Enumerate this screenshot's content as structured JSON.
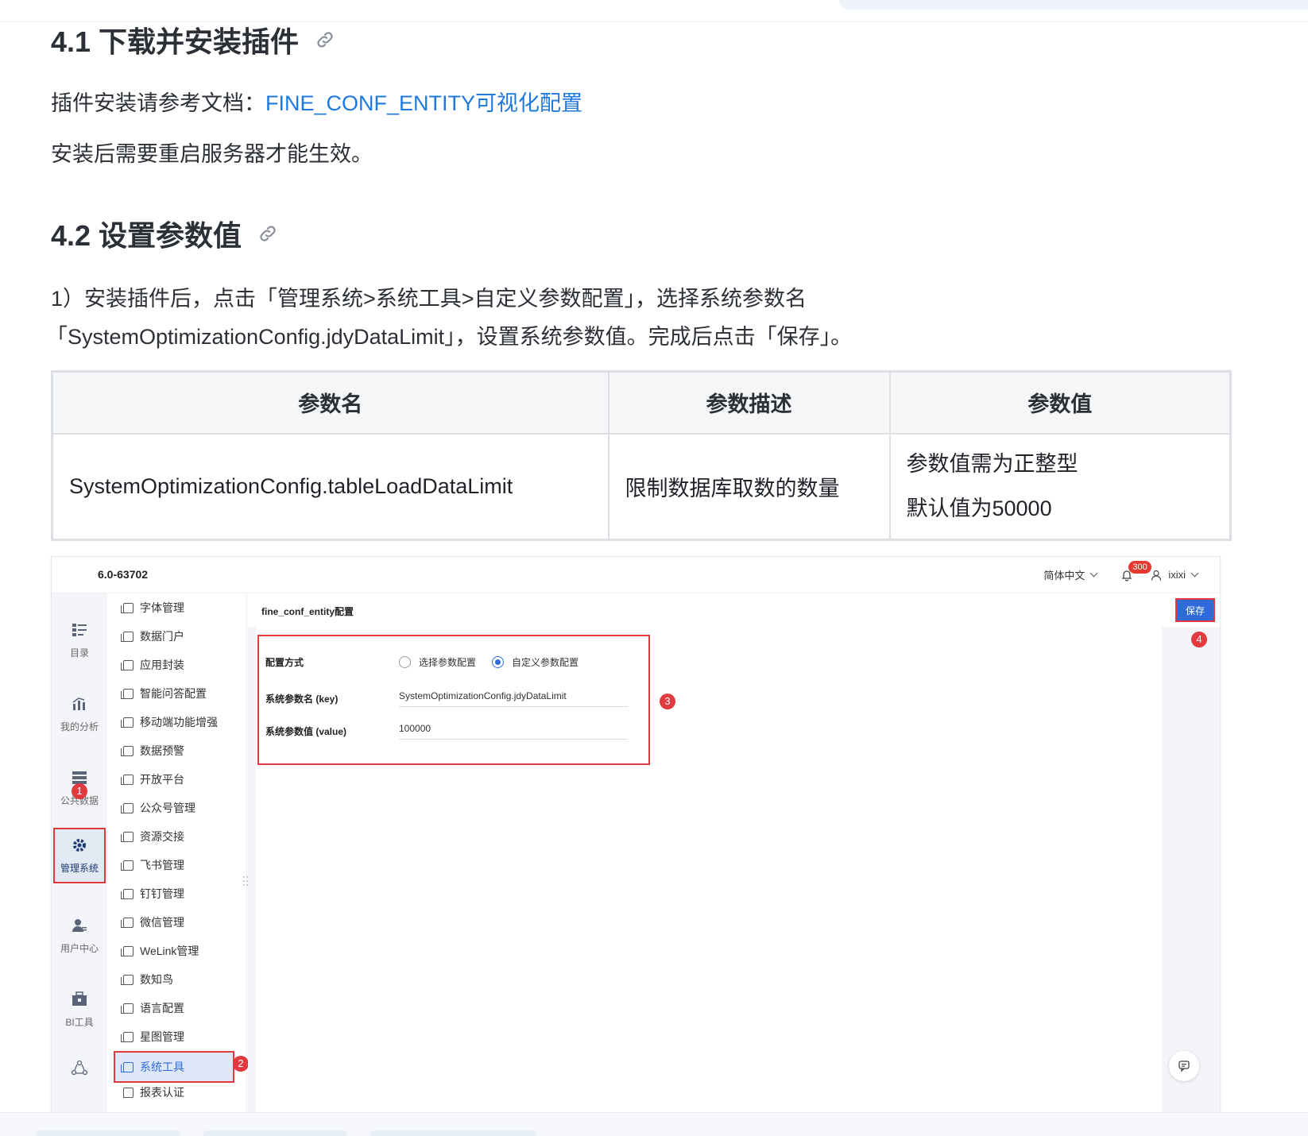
{
  "doc": {
    "section_41": {
      "title": "4.1 下载并安装插件"
    },
    "install_prefix": "插件安装请参考文档：",
    "install_link": "FINE_CONF_ENTITY可视化配置",
    "restart_note": "安装后需要重启服务器才能生效。",
    "section_42": {
      "title": "4.2 设置参数值"
    },
    "step1_line1": "1）安装插件后，点击「管理系统>系统工具>自定义参数配置」，选择系统参数名",
    "step1_line2": "「SystemOptimizationConfig.jdyDataLimit」，设置系统参数值。完成后点击「保存」。",
    "table": {
      "headers": [
        "参数名",
        "参数描述",
        "参数值"
      ],
      "rows": [
        {
          "name": "SystemOptimizationConfig.tableLoadDataLimit",
          "desc": "限制数据库取数的数量",
          "value_line1": "参数值需为正整型",
          "value_line2": "默认值为50000"
        }
      ]
    }
  },
  "app": {
    "version": "6.0-63702",
    "language": "简体中文",
    "notification_count": "300",
    "user": "ixixi",
    "sidebar": [
      {
        "label": "目录",
        "icon": "catalog-icon"
      },
      {
        "label": "我的分析",
        "icon": "analysis-icon"
      },
      {
        "label": "公共数据",
        "icon": "public-data-icon"
      },
      {
        "label": "管理系统",
        "icon": "gear-icon",
        "active": true
      },
      {
        "label": "用户中心",
        "icon": "user-center-icon"
      },
      {
        "label": "BI工具",
        "icon": "bi-tools-icon"
      },
      {
        "label": "",
        "icon": "network-icon"
      }
    ],
    "menu": [
      "字体管理",
      "数据门户",
      "应用封装",
      "智能问答配置",
      "移动端功能增强",
      "数据预警",
      "开放平台",
      "公众号管理",
      "资源交接",
      "飞书管理",
      "钉钉管理",
      "微信管理",
      "WeLink管理",
      "数知鸟",
      "语言配置",
      "星图管理",
      "系统工具",
      "报表认证"
    ],
    "content_title": "fine_conf_entity配置",
    "save_label": "保存",
    "form": {
      "mode_label": "配置方式",
      "option_select": "选择参数配置",
      "option_custom": "自定义参数配置",
      "key_label": "系统参数名 (key)",
      "key_value": "SystemOptimizationConfig.jdyDataLimit",
      "value_label": "系统参数值 (value)",
      "value_value": "100000"
    },
    "markers": [
      "1",
      "2",
      "3",
      "4"
    ]
  }
}
